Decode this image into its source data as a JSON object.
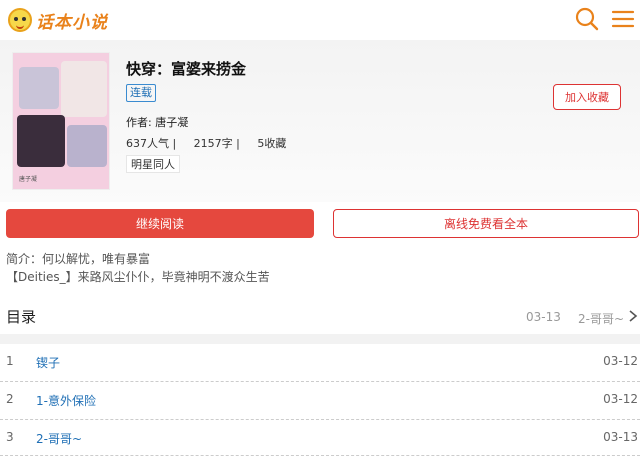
{
  "header": {
    "logo_text": "话本小说",
    "icons": [
      "search-icon",
      "menu-icon"
    ],
    "accent_color": "#e9821b"
  },
  "book": {
    "title": "快穿：富婆来捞金",
    "status_tag": "连载",
    "author_line": "作者: 唐子凝",
    "stats_line": "637人气 |     2157字 |     5收藏",
    "genre_tag": "明星同人",
    "fav_button": "加入收藏",
    "cover_caption": "唐子凝"
  },
  "actions": {
    "continue_read": "继续阅读",
    "offline_read": "离线免费看全本",
    "primary_color": "#e5483e"
  },
  "intro": {
    "line1": "简介：何以解忧，唯有暴富",
    "line2": "【Deities_】来路风尘仆仆，毕竟神明不渡众生苦"
  },
  "toc": {
    "title": "目录",
    "latest_date": "03-13",
    "latest_chapter": "2-哥哥~",
    "chapters": [
      {
        "num": "1",
        "name": "锲子",
        "date": "03-12"
      },
      {
        "num": "2",
        "name": "1-意外保险",
        "date": "03-12"
      },
      {
        "num": "3",
        "name": "2-哥哥~",
        "date": "03-13"
      }
    ]
  }
}
